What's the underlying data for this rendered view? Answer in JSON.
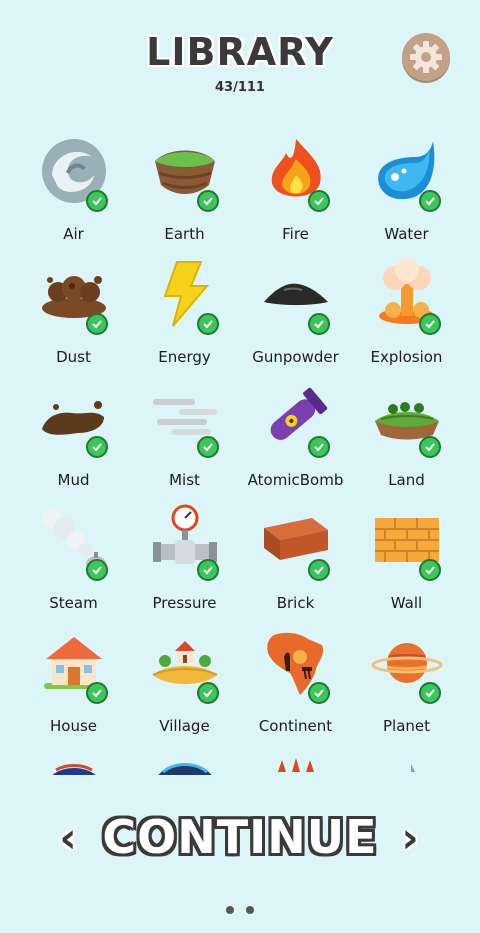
{
  "header": {
    "title": "LIBRARY",
    "count": "43/111",
    "settings_icon": "gear-icon"
  },
  "elements": [
    {
      "label": "Air",
      "icon": "air-icon"
    },
    {
      "label": "Earth",
      "icon": "earth-icon"
    },
    {
      "label": "Fire",
      "icon": "fire-icon"
    },
    {
      "label": "Water",
      "icon": "water-icon"
    },
    {
      "label": "Dust",
      "icon": "dust-icon"
    },
    {
      "label": "Energy",
      "icon": "energy-icon"
    },
    {
      "label": "Gunpowder",
      "icon": "gunpowder-icon"
    },
    {
      "label": "Explosion",
      "icon": "explosion-icon"
    },
    {
      "label": "Mud",
      "icon": "mud-icon"
    },
    {
      "label": "Mist",
      "icon": "mist-icon"
    },
    {
      "label": "AtomicBomb",
      "icon": "atomic-bomb-icon"
    },
    {
      "label": "Land",
      "icon": "land-icon"
    },
    {
      "label": "Steam",
      "icon": "steam-icon"
    },
    {
      "label": "Pressure",
      "icon": "pressure-icon"
    },
    {
      "label": "Brick",
      "icon": "brick-icon"
    },
    {
      "label": "Wall",
      "icon": "wall-icon"
    },
    {
      "label": "House",
      "icon": "house-icon"
    },
    {
      "label": "Village",
      "icon": "village-icon"
    },
    {
      "label": "Continent",
      "icon": "continent-icon"
    },
    {
      "label": "Planet",
      "icon": "planet-icon"
    }
  ],
  "footer": {
    "continue_label": "CONTINUE",
    "left_arrow": "‹",
    "right_arrow": "›"
  },
  "colors": {
    "background": "#dcf5f9",
    "check": "#3cc55a",
    "settings": "#c3a187"
  }
}
